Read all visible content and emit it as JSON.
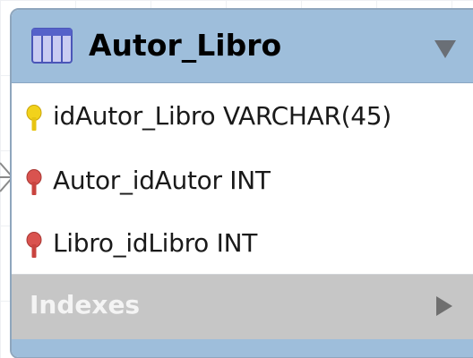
{
  "table": {
    "name": "Autor_Libro",
    "columns": [
      {
        "text": "idAutor_Libro VARCHAR(45)",
        "key": "primary-key-icon"
      },
      {
        "text": "Autor_idAutor INT",
        "key": "foreign-key-icon"
      },
      {
        "text": "Libro_idLibro INT",
        "key": "foreign-key-icon"
      }
    ],
    "indexes_label": "Indexes"
  },
  "icons": {
    "header": "table-icon",
    "collapse": "triangle-down-icon",
    "expand": "triangle-right-icon"
  },
  "colors": {
    "header_bg": "#9ebedb",
    "border": "#8fa6bd",
    "indexes_bg": "#c6c6c6",
    "primary_key": "#f2d21b",
    "foreign_key": "#d9534f"
  }
}
